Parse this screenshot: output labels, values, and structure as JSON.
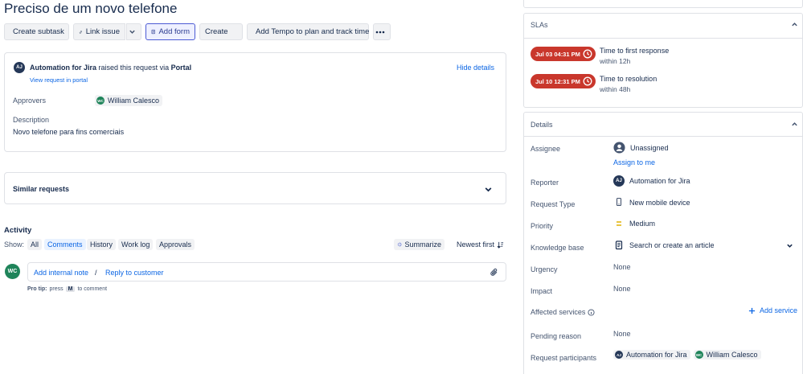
{
  "issue": {
    "title": "Preciso de um novo telefone"
  },
  "toolbar": {
    "create_subtask": "Create subtask",
    "link_issue": "Link issue",
    "add_form": "Add form",
    "create": "Create",
    "tempo": "Add Tempo to plan and track time"
  },
  "request": {
    "raised_by": "Automation for Jira",
    "raised_text": "raised this request via",
    "channel": "Portal",
    "view_portal": "View request in portal",
    "hide_details": "Hide details",
    "approvers_label": "Approvers",
    "approver": "William Calesco",
    "description_label": "Description",
    "description": "Novo telefone para fins comerciais",
    "avatar_initials": "AJ",
    "approver_initials": "WC"
  },
  "similar": {
    "label": "Similar requests"
  },
  "activity": {
    "title": "Activity",
    "show_label": "Show:",
    "tabs": [
      "All",
      "Comments",
      "History",
      "Work log",
      "Approvals"
    ],
    "summarize": "Summarize",
    "sort": "Newest first",
    "user_initials": "WC",
    "internal_note": "Add internal note",
    "separator": "/",
    "reply": "Reply to customer",
    "pro_tip_label": "Pro tip:",
    "pro_tip_press": "press",
    "pro_tip_key": "M",
    "pro_tip_rest": "to comment"
  },
  "slas": {
    "title": "SLAs",
    "items": [
      {
        "badge": "Jul 03 04:31 PM",
        "name": "Time to first response",
        "within": "within 12h"
      },
      {
        "badge": "Jul 10 12:31 PM",
        "name": "Time to resolution",
        "within": "within 48h"
      }
    ]
  },
  "details": {
    "title": "Details",
    "assignee_label": "Assignee",
    "assignee": "Unassigned",
    "assign_to_me": "Assign to me",
    "reporter_label": "Reporter",
    "reporter": "Automation for Jira",
    "request_type_label": "Request Type",
    "request_type": "New mobile device",
    "priority_label": "Priority",
    "priority": "Medium",
    "kb_label": "Knowledge base",
    "kb_placeholder": "Search or create an article",
    "urgency_label": "Urgency",
    "urgency": "None",
    "impact_label": "Impact",
    "impact": "None",
    "affected_label": "Affected services",
    "add_service": "Add service",
    "pending_label": "Pending reason",
    "pending": "None",
    "participants_label": "Request participants",
    "participants": [
      "Automation for Jira",
      "William Calesco"
    ],
    "participant_initials": [
      "AJ",
      "WC"
    ]
  },
  "colors": {
    "brand_link": "#0c66e4",
    "sla_red": "#c9372c",
    "avatar_green": "#1f845a",
    "avatar_dark": "#253858",
    "priority_medium": "#e2b203"
  }
}
